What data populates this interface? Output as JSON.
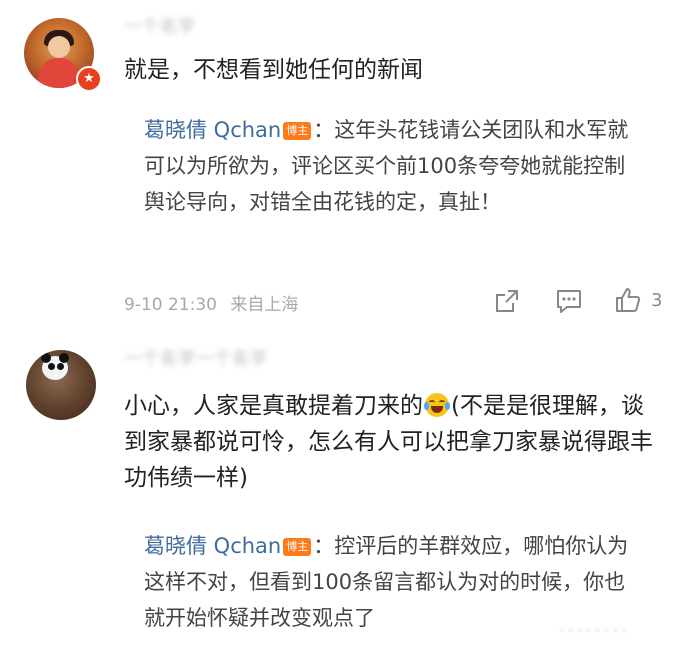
{
  "comments": [
    {
      "username": "一个名字",
      "text": "就是，不想看到她任何的新闻",
      "badge_icon": "★",
      "reply": {
        "author": "葛晓倩 Qchan",
        "author_tag": "博主",
        "text": "：这年头花钱请公关团队和水军就可以为所欲为，评论区买个前100条夸夸她就能控制舆论导向，对错全由花钱的定，真扯！"
      },
      "meta": {
        "time": "9-10 21:30",
        "location": "来自上海"
      },
      "actions": {
        "share_icon": "share-icon",
        "comment_icon": "comment-icon",
        "like_icon": "thumbs-up-icon",
        "like_count": "3"
      }
    },
    {
      "username": "一个名字一个名字",
      "text_before_emoji": "小心，人家是真敢提着刀来的",
      "emoji_icon": "laugh-cry-emoji-icon",
      "text_after_emoji": "(不是是很理解，谈到家暴都说可怜，怎么有人可以把拿刀家暴说得跟丰功伟绩一样)",
      "reply": {
        "author": "葛晓倩 Qchan",
        "author_tag": "博主",
        "text": "：控评后的羊群效应，哪怕你认为这样不对，但看到100条留言都认为对的时候，你也就开始怀疑并改变观点了"
      }
    }
  ],
  "colors": {
    "reply_name": "#3f6c9c",
    "author_tag_bg": "#ff7a1a",
    "badge_bg": "#e8401c",
    "meta_text": "#a8a8a8"
  }
}
